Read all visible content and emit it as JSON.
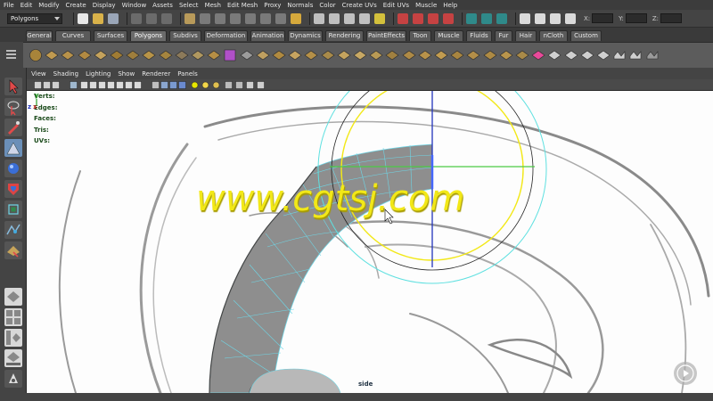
{
  "menubar": {
    "items": [
      "File",
      "Edit",
      "Modify",
      "Create",
      "Display",
      "Window",
      "Assets",
      "Select",
      "Mesh",
      "Edit Mesh",
      "Proxy",
      "Normals",
      "Color",
      "Create UVs",
      "Edit UVs",
      "Muscle",
      "Help"
    ]
  },
  "statusline": {
    "mode": "Polygons",
    "x_label": "X:",
    "y_label": "Y:",
    "z_label": "Z:"
  },
  "shelf_tabs": {
    "items": [
      "General",
      "Curves",
      "Surfaces",
      "Polygons",
      "Subdivs",
      "Deformation",
      "Animation",
      "Dynamics",
      "Rendering",
      "PaintEffects",
      "Toon",
      "Muscle",
      "Fluids",
      "Fur",
      "Hair",
      "nCloth",
      "Custom"
    ],
    "active": "Polygons"
  },
  "viewport_menu": {
    "items": [
      "View",
      "Shading",
      "Lighting",
      "Show",
      "Renderer",
      "Panels"
    ]
  },
  "hud": {
    "verts": "Verts:",
    "edges": "Edges:",
    "faces": "Faces:",
    "tris": "Tris:",
    "uvs": "UVs:"
  },
  "viewport": {
    "camera": "side",
    "axis_y": "y",
    "axis_z": "z",
    "axis_x": "x"
  },
  "watermark": "www.cgtsj.com",
  "colors": {
    "panel": "#444444",
    "shelf": "#5c5c5c",
    "viewport_bg": "#fdfdfd",
    "manip_yellow": "#f2e818",
    "manip_cyan": "#5ee0e0",
    "manip_green": "#4ccc44",
    "manip_blue": "#2233bb",
    "mesh_wire": "#6fd6e6",
    "watermark": "#f2e818"
  },
  "icons": [
    "select-tool-icon",
    "lasso-icon",
    "paint-select-icon",
    "move-icon",
    "rotate-icon",
    "scale-icon",
    "manipulator-icon",
    "soft-mod-icon",
    "last-tool-icon",
    "layout-single-icon",
    "layout-four-icon",
    "layout-outliner-icon",
    "layout-graph-icon",
    "layout-persp-icon",
    "play-icon"
  ]
}
